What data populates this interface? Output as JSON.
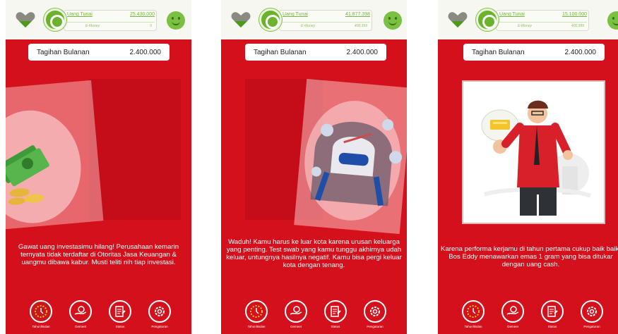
{
  "screens": [
    {
      "balance_label": "Uang Tunai",
      "balance_value": "25.430.000",
      "emoney_label": "E-Money",
      "emoney_value": "0",
      "bill_label": "Tagihan Bulanan",
      "bill_value": "2.400.000",
      "story_text": "Gawat uang investasimu hilang! Perusahaan kemarin ternyata tidak terdaftar di Otoritas Jasa Keuangan & uangmu dibawa kabur. Musti teliti nih tiap investasi."
    },
    {
      "balance_label": "Uang Tunai",
      "balance_value": "41.877.398",
      "emoney_label": "E-Money",
      "emoney_value": "400.399",
      "bill_label": "Tagihan Bulanan",
      "bill_value": "2.400.000",
      "story_text": "Waduh! Kamu harus ke luar kota karena urusan keluarga yang penting. Test swab yang kamu tunggu akhirnya udah keluar, untungnya hasilnya negatif. Kamu bisa pergi keluar kota dengan tenang."
    },
    {
      "balance_label": "Uang Tunai",
      "balance_value": "15.100.000",
      "emoney_label": "E-Money",
      "emoney_value": "400.399",
      "bill_label": "Tagihan Bulanan",
      "bill_value": "2.400.000",
      "story_text": "Karena performa kerjamu di tahun pertama cukup baik baik, Bos Eddy menawarkan emas 1 gram yang bisa ditukar dengan uang cash."
    }
  ],
  "nav": {
    "year": "Tahun/Bulan",
    "savings": "Gemeet",
    "status": "Status",
    "settings": "Pengaturan"
  },
  "colors": {
    "background_red": "#d3101b",
    "accent_green": "#6bb22d",
    "topbar": "#f7f7f2"
  },
  "icons": [
    "heart-icon",
    "coin-icon",
    "smiley-icon",
    "clock-icon",
    "hand-money-icon",
    "document-icon",
    "gear-icon"
  ]
}
